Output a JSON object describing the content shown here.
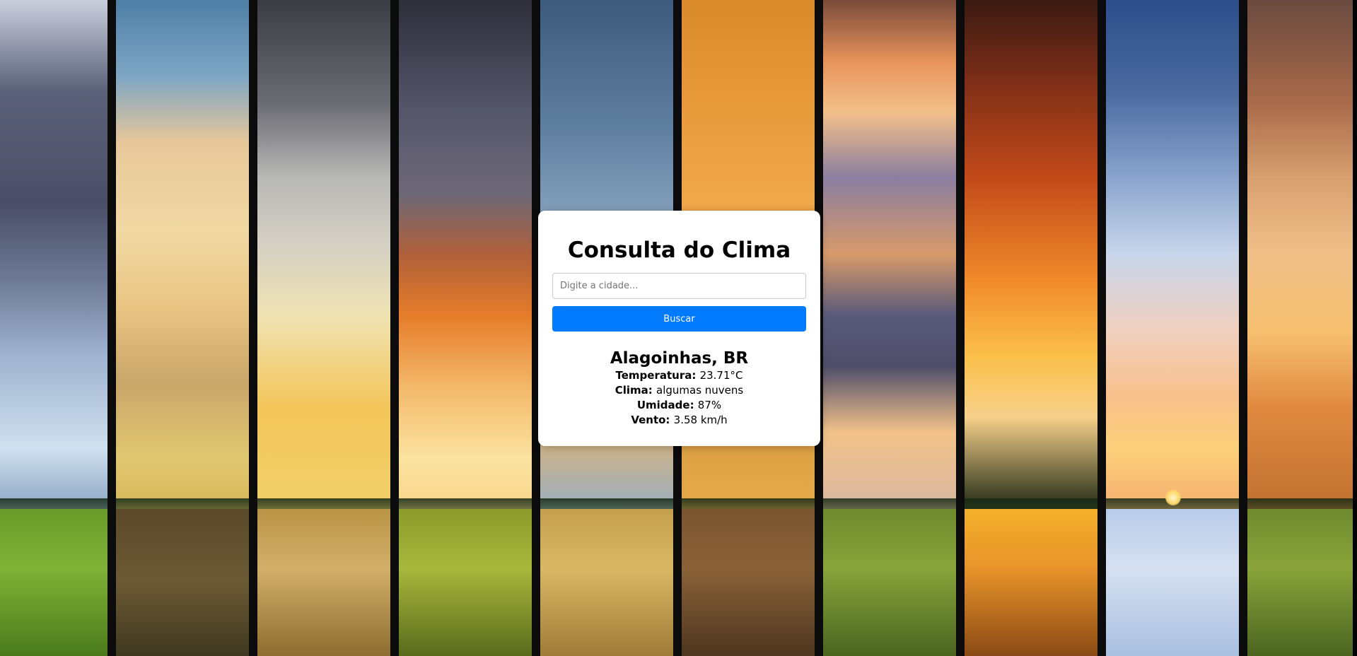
{
  "app": {
    "title": "Consulta do Clima"
  },
  "search": {
    "placeholder": "Digite a cidade...",
    "value": "",
    "button_label": "Buscar"
  },
  "result": {
    "location": "Alagoinhas, BR",
    "rows": [
      {
        "label": "Temperatura:",
        "value": "23.71°C"
      },
      {
        "label": "Clima:",
        "value": "algumas nuvens"
      },
      {
        "label": "Umidade:",
        "value": "87%"
      },
      {
        "label": "Vento:",
        "value": "3.58 km/h"
      }
    ]
  },
  "theme": {
    "button_color": "#007bff",
    "card_background": "#ffffff"
  }
}
